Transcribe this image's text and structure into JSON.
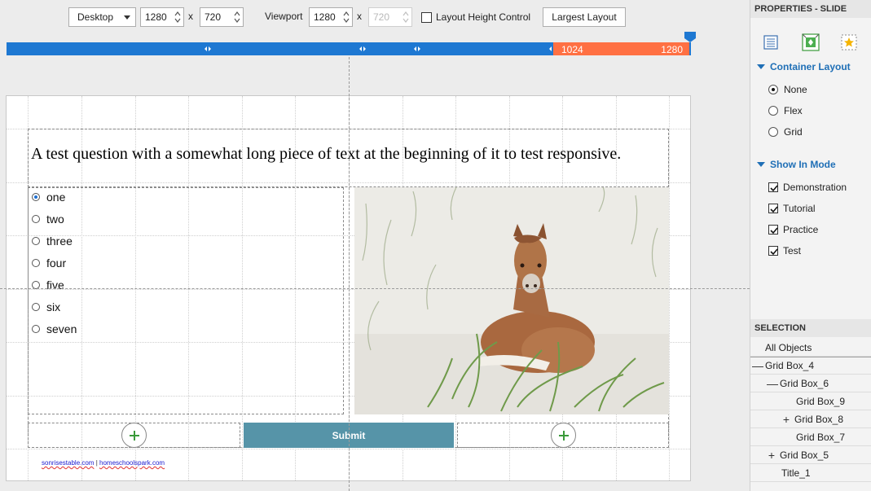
{
  "toolbar": {
    "device": "Desktop",
    "width": "1280",
    "height": "720",
    "x_separator": "x",
    "viewport_label": "Viewport",
    "viewport_width": "1280",
    "viewport_height": "720",
    "layout_height_control": "Layout Height Control",
    "largest_layout": "Largest Layout"
  },
  "breakpoints": {
    "labels": [
      "1024",
      "1280"
    ]
  },
  "slide": {
    "question": "A test question with a somewhat long piece of text at the beginning of it to test responsive.",
    "choices": [
      {
        "label": "one",
        "selected": true
      },
      {
        "label": "two",
        "selected": false
      },
      {
        "label": "three",
        "selected": false
      },
      {
        "label": "four",
        "selected": false
      },
      {
        "label": "five",
        "selected": false
      },
      {
        "label": "six",
        "selected": false
      },
      {
        "label": "seven",
        "selected": false
      }
    ],
    "submit": "Submit",
    "credit_left": "sonrisestable.com",
    "credit_sep": " | ",
    "credit_right": "homeschoolspark.com"
  },
  "panel": {
    "properties_title": "PROPERTIES - SLIDE",
    "container_layout": {
      "title": "Container Layout",
      "options": [
        "None",
        "Flex",
        "Grid"
      ],
      "selected": "None"
    },
    "show_in_mode": {
      "title": "Show In Mode",
      "options": [
        {
          "label": "Demonstration",
          "checked": true
        },
        {
          "label": "Tutorial",
          "checked": true
        },
        {
          "label": "Practice",
          "checked": true
        },
        {
          "label": "Test",
          "checked": true
        }
      ]
    },
    "selection_title": "SELECTION",
    "tree": [
      {
        "label": "All Objects",
        "expander": ""
      },
      {
        "label": "Grid Box_4",
        "expander": "—"
      },
      {
        "label": "Grid Box_6",
        "expander": "—"
      },
      {
        "label": "Grid Box_9",
        "expander": ""
      },
      {
        "label": "Grid Box_8",
        "expander": "+"
      },
      {
        "label": "Grid Box_7",
        "expander": ""
      },
      {
        "label": "Grid Box_5",
        "expander": "+"
      },
      {
        "label": "Title_1",
        "expander": ""
      }
    ]
  },
  "colors": {
    "breakpoint_bar": "#1e78d2",
    "active_breakpoint": "#ff7043",
    "submit": "#5694a8",
    "accent_blue": "#1f6fb6",
    "add_plus": "#3a9a3a"
  }
}
